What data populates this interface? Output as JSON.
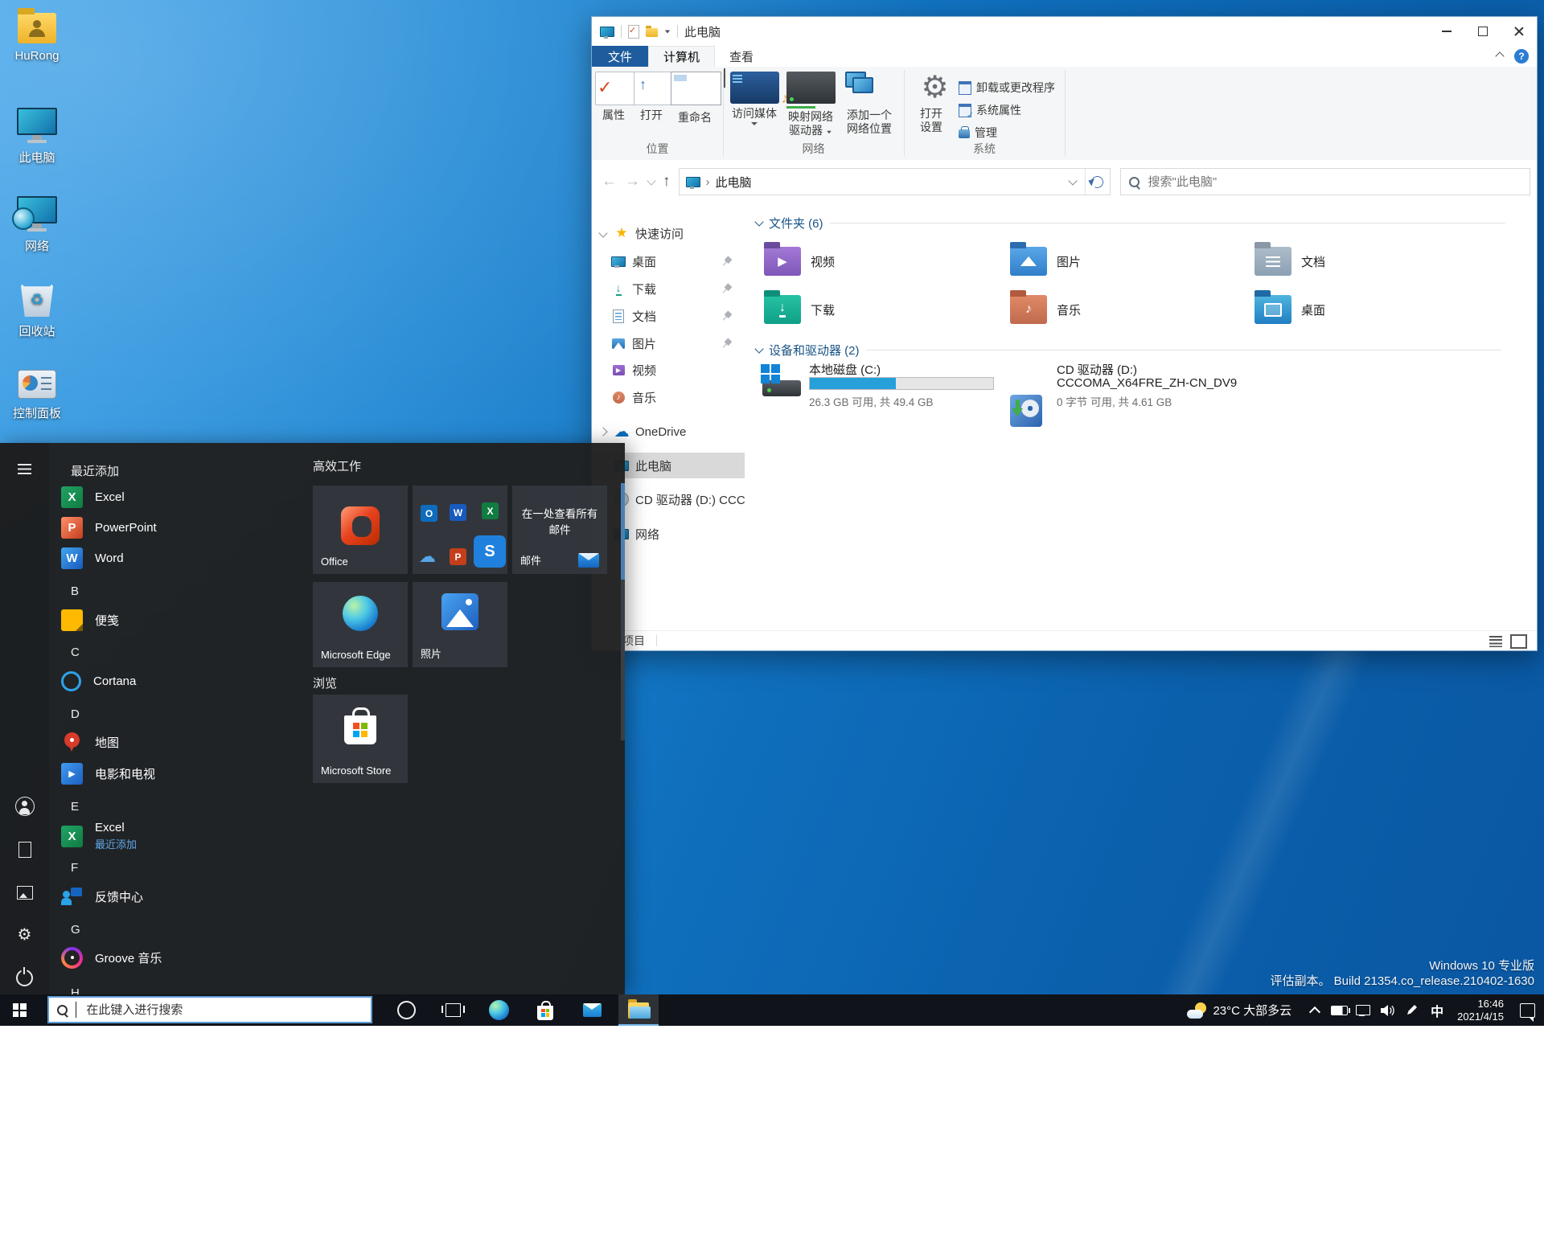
{
  "colors": {
    "accent": "#0078d7",
    "desktop_top": "#3aa0e8",
    "desktop_bottom": "#0a57a2",
    "file_tab_blue": "#1e5c9e",
    "nav_selection": "#d9d9d9",
    "drive_bar_fill": "#26a0da",
    "taskbar_bg": "#10141a",
    "start_menu_bg": "#212121",
    "tile_bg": "#34383e"
  },
  "desktop": {
    "icons": [
      {
        "label": "HuRong",
        "icon": "user-folder-icon"
      },
      {
        "label": "此电脑",
        "icon": "this-pc-icon"
      },
      {
        "label": "网络",
        "icon": "network-icon"
      },
      {
        "label": "回收站",
        "icon": "recycle-bin-icon"
      },
      {
        "label": "控制面板",
        "icon": "control-panel-icon"
      }
    ],
    "watermark": {
      "line1": "Windows 10 专业版",
      "line2": "评估副本。  Build 21354.co_release.210402-1630"
    }
  },
  "explorer": {
    "title": "此电脑",
    "tabs": {
      "file": "文件",
      "computer": "计算机",
      "view": "查看"
    },
    "ribbon": {
      "properties": "属性",
      "open": "打开",
      "rename": "重命名",
      "access_media": "访问媒体",
      "map_drive_1": "映射网络",
      "map_drive_2": "驱动器",
      "add_location_1": "添加一个",
      "add_location_2": "网络位置",
      "open_settings_1": "打开",
      "open_settings_2": "设置",
      "uninstall": "卸载或更改程序",
      "system_props": "系统属性",
      "manage": "管理",
      "group_location": "位置",
      "group_network": "网络",
      "group_system": "系统"
    },
    "address": {
      "path": "此电脑",
      "search_placeholder": "搜索\"此电脑\""
    },
    "nav": {
      "quick_access": "快速访问",
      "desktop": "桌面",
      "downloads": "下载",
      "documents": "文档",
      "pictures": "图片",
      "videos": "视频",
      "music": "音乐",
      "onedrive": "OneDrive",
      "this_pc": "此电脑",
      "cd_drive": "CD 驱动器 (D:) CCC",
      "network": "网络"
    },
    "sections": {
      "folders": "文件夹 (6)",
      "devices": "设备和驱动器 (2)"
    },
    "folders": [
      {
        "label": "视频",
        "icon": "folder-videos"
      },
      {
        "label": "图片",
        "icon": "folder-pictures"
      },
      {
        "label": "文档",
        "icon": "folder-documents"
      },
      {
        "label": "下载",
        "icon": "folder-downloads"
      },
      {
        "label": "音乐",
        "icon": "folder-music"
      },
      {
        "label": "桌面",
        "icon": "folder-desktop"
      }
    ],
    "drives": {
      "c": {
        "name": "本地磁盘 (C:)",
        "detail": "26.3 GB 可用, 共 49.4 GB",
        "used_percent": 47
      },
      "d": {
        "name": "CD 驱动器 (D:)",
        "volume": "CCCOMA_X64FRE_ZH-CN_DV9",
        "detail": "0 字节 可用, 共 4.61 GB"
      }
    },
    "statusbar": {
      "items": "项目"
    }
  },
  "start_menu": {
    "recent_header": "最近添加",
    "list": [
      {
        "label": "Excel",
        "icon": "excel-icon"
      },
      {
        "label": "PowerPoint",
        "icon": "powerpoint-icon"
      },
      {
        "label": "Word",
        "icon": "word-icon"
      },
      {
        "label": "B"
      },
      {
        "label": "便笺",
        "icon": "sticky-notes-icon"
      },
      {
        "label": "C"
      },
      {
        "label": "Cortana",
        "icon": "cortana-icon"
      },
      {
        "label": "D"
      },
      {
        "label": "地图",
        "icon": "maps-icon"
      },
      {
        "label": "电影和电视",
        "icon": "movies-tv-icon"
      },
      {
        "label": "E"
      },
      {
        "label": "Excel",
        "sub": "最近添加",
        "icon": "excel-icon"
      },
      {
        "label": "F"
      },
      {
        "label": "反馈中心",
        "icon": "feedback-hub-icon"
      },
      {
        "label": "G"
      },
      {
        "label": "Groove 音乐",
        "icon": "groove-music-icon"
      },
      {
        "label": "H"
      }
    ],
    "groups": {
      "productivity": "高效工作",
      "explore": "浏览"
    },
    "tiles": {
      "office": "Office",
      "mail_text": "在一处查看所有邮件",
      "mail_label": "邮件",
      "edge": "Microsoft Edge",
      "photos": "照片",
      "store": "Microsoft Store"
    }
  },
  "taskbar": {
    "search_placeholder": "在此键入进行搜索",
    "tray": {
      "weather": "23°C 大部多云",
      "ime": "中",
      "time": "16:46",
      "date": "2021/4/15"
    }
  }
}
